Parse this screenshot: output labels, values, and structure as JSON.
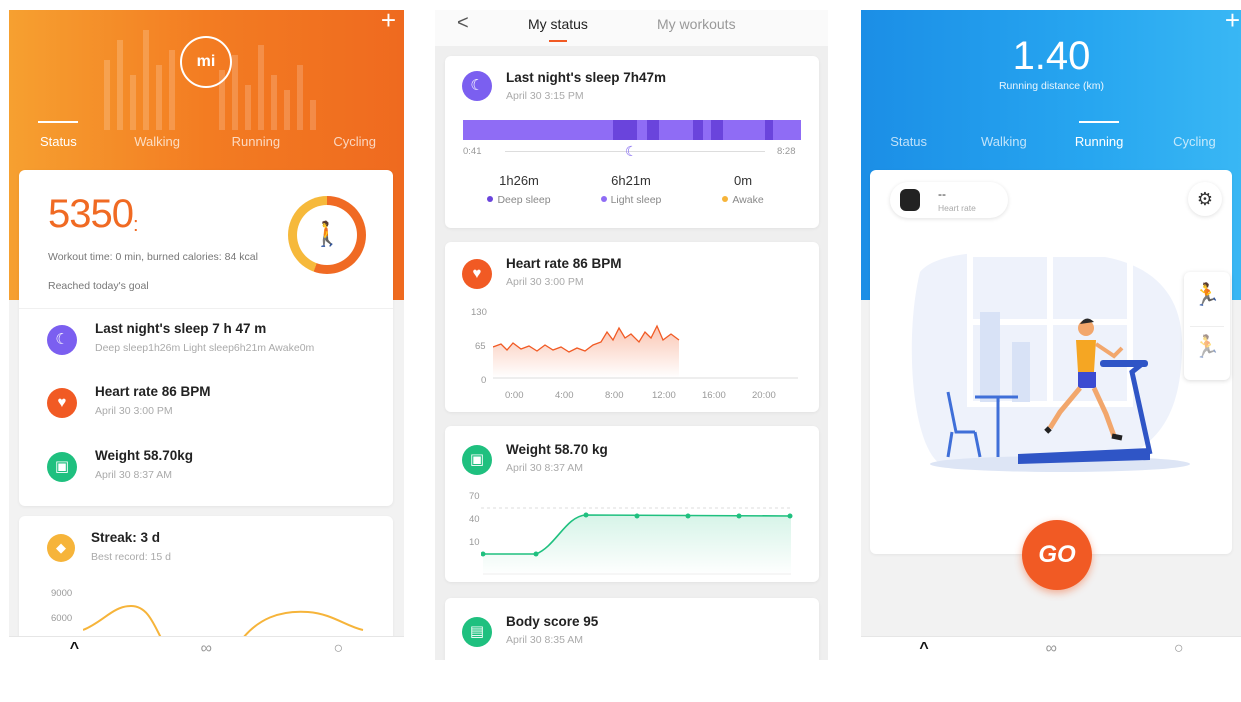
{
  "screen1": {
    "plus": "+",
    "logo": "mi",
    "tabs": [
      "Status",
      "Walking",
      "Running",
      "Cycling"
    ],
    "steps": "5350",
    "steps_suffix": ":",
    "workout_summary": "Workout time: 0 min, burned calories: 84 kcal",
    "goal_text": "Reached today's goal",
    "sleep": {
      "title": "Last night's sleep 7 h 47 m",
      "sub": "Deep sleep1h26m Light sleep6h21m Awake0m"
    },
    "heart": {
      "title": "Heart rate 86 BPM",
      "sub": "April 30 3:00 PM"
    },
    "weight": {
      "title": "Weight 58.70kg",
      "sub": "April 30 8:37 AM"
    },
    "streak": {
      "title": "Streak: 3 d",
      "sub": "Best record: 15 d",
      "y_ticks": [
        "9000",
        "6000"
      ]
    }
  },
  "screen2": {
    "back": "<",
    "tabs": {
      "status": "My status",
      "workouts": "My workouts"
    },
    "sleep": {
      "title": "Last night's sleep 7h47m",
      "date": "April 30 3:15 PM",
      "start": "0:41",
      "end": "8:28",
      "deep": "1h26m",
      "light": "6h21m",
      "awake": "0m",
      "deep_label": "Deep sleep",
      "light_label": "Light sleep",
      "awake_label": "Awake"
    },
    "heart": {
      "title": "Heart rate 86  BPM",
      "date": "April 30 3:00 PM",
      "y_ticks": [
        "130",
        "65",
        "0"
      ],
      "x_ticks": [
        "0:00",
        "4:00",
        "8:00",
        "12:00",
        "16:00",
        "20:00"
      ]
    },
    "weight": {
      "title": "Weight 58.70 kg",
      "date": "April 30 8:37 AM",
      "y_ticks": [
        "70",
        "40",
        "10"
      ]
    },
    "body": {
      "title": "Body score 95",
      "date": "April 30 8:35 AM"
    }
  },
  "screen3": {
    "plus": "+",
    "distance": "1.40",
    "distance_label": "Running distance (km)",
    "tabs": [
      "Status",
      "Walking",
      "Running",
      "Cycling"
    ],
    "hr_value": "--",
    "hr_label": "Heart rate",
    "go": "GO"
  },
  "colors": {
    "orange": "#f06a23",
    "blue": "#1b8ee6",
    "purple": "#7b5ff0",
    "green": "#1fc07f",
    "yellow": "#f6b43a"
  }
}
